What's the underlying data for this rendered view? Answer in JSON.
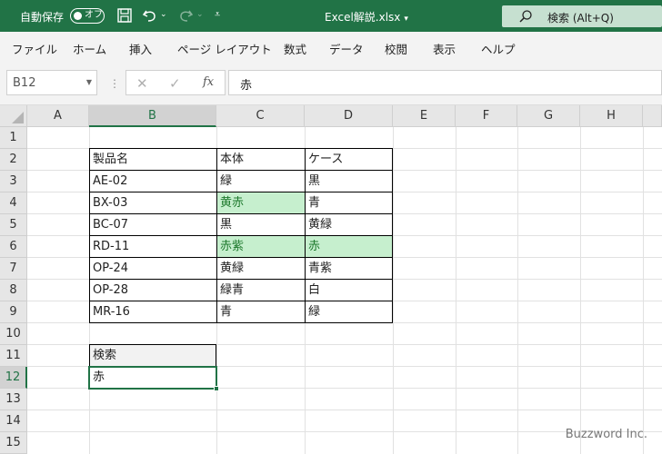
{
  "titlebar": {
    "autosave_label": "自動保存",
    "autosave_state": "オフ",
    "doc_title": "Excel解説.xlsx",
    "search_text": "検索 (Alt+Q)"
  },
  "ribbon": {
    "tabs": [
      "ファイル",
      "ホーム",
      "挿入",
      "ページ レイアウト",
      "数式",
      "データ",
      "校閲",
      "表示",
      "ヘルプ"
    ]
  },
  "formula_bar": {
    "name_box": "B12",
    "content": "赤"
  },
  "columns": [
    "A",
    "B",
    "C",
    "D",
    "E",
    "F",
    "G",
    "H"
  ],
  "rows": [
    "1",
    "2",
    "3",
    "4",
    "5",
    "6",
    "7",
    "8",
    "9",
    "10",
    "11",
    "12",
    "13",
    "14",
    "15"
  ],
  "table": {
    "headers": [
      "製品名",
      "本体",
      "ケース"
    ],
    "rows": [
      [
        "AE-02",
        "緑",
        "黒"
      ],
      [
        "BX-03",
        "黄赤",
        "青"
      ],
      [
        "BC-07",
        "黒",
        "黄緑"
      ],
      [
        "RD-11",
        "赤紫",
        "赤"
      ],
      [
        "OP-24",
        "黄緑",
        "青紫"
      ],
      [
        "OP-28",
        "緑青",
        "白"
      ],
      [
        "MR-16",
        "青",
        "緑"
      ]
    ]
  },
  "search": {
    "label": "検索",
    "value": "赤"
  },
  "watermark": "Buzzword Inc.",
  "colors": {
    "brand_green": "#217346",
    "highlight_fill": "#c6efce",
    "highlight_text": "#1f7a2e"
  }
}
